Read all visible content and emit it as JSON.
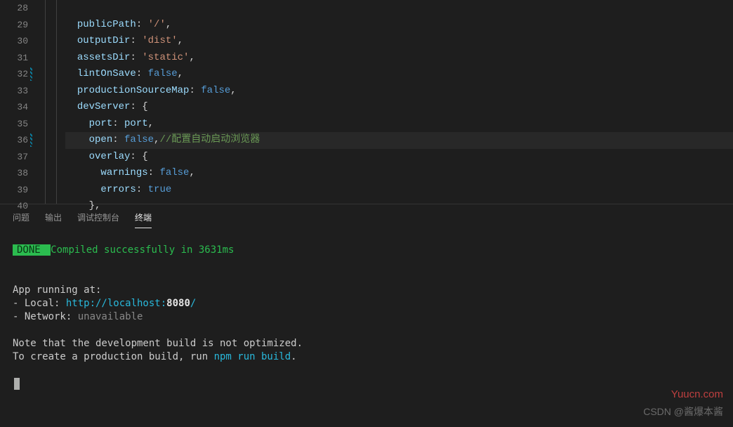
{
  "editor": {
    "lines": [
      {
        "num": "28",
        "mod": false,
        "indent": 0,
        "tokens": []
      },
      {
        "num": "29",
        "mod": false,
        "indent": 1,
        "tokens": [
          [
            "prop",
            "publicPath"
          ],
          [
            "punc",
            ": "
          ],
          [
            "str",
            "'/'"
          ],
          [
            "punc",
            ","
          ]
        ]
      },
      {
        "num": "30",
        "mod": false,
        "indent": 1,
        "tokens": [
          [
            "prop",
            "outputDir"
          ],
          [
            "punc",
            ": "
          ],
          [
            "str",
            "'dist'"
          ],
          [
            "punc",
            ","
          ]
        ]
      },
      {
        "num": "31",
        "mod": false,
        "indent": 1,
        "tokens": [
          [
            "prop",
            "assetsDir"
          ],
          [
            "punc",
            ": "
          ],
          [
            "str",
            "'static'"
          ],
          [
            "punc",
            ","
          ]
        ]
      },
      {
        "num": "32",
        "mod": true,
        "indent": 1,
        "tokens": [
          [
            "prop",
            "lintOnSave"
          ],
          [
            "punc",
            ": "
          ],
          [
            "bool",
            "false"
          ],
          [
            "punc",
            ","
          ]
        ]
      },
      {
        "num": "33",
        "mod": false,
        "indent": 1,
        "tokens": [
          [
            "prop",
            "productionSourceMap"
          ],
          [
            "punc",
            ": "
          ],
          [
            "bool",
            "false"
          ],
          [
            "punc",
            ","
          ]
        ]
      },
      {
        "num": "34",
        "mod": false,
        "indent": 1,
        "tokens": [
          [
            "prop",
            "devServer"
          ],
          [
            "punc",
            ": {"
          ]
        ]
      },
      {
        "num": "35",
        "mod": false,
        "indent": 2,
        "tokens": [
          [
            "prop",
            "port"
          ],
          [
            "punc",
            ": "
          ],
          [
            "var",
            "port"
          ],
          [
            "punc",
            ","
          ]
        ]
      },
      {
        "num": "36",
        "mod": true,
        "indent": 2,
        "hl": true,
        "tokens": [
          [
            "prop",
            "open"
          ],
          [
            "punc",
            ": "
          ],
          [
            "bool",
            "false"
          ],
          [
            "punc",
            ","
          ],
          [
            "comment",
            "//配置自动启动浏览器"
          ]
        ]
      },
      {
        "num": "37",
        "mod": false,
        "indent": 2,
        "tokens": [
          [
            "prop",
            "overlay"
          ],
          [
            "punc",
            ": {"
          ]
        ]
      },
      {
        "num": "38",
        "mod": false,
        "indent": 3,
        "tokens": [
          [
            "prop",
            "warnings"
          ],
          [
            "punc",
            ": "
          ],
          [
            "bool",
            "false"
          ],
          [
            "punc",
            ","
          ]
        ]
      },
      {
        "num": "39",
        "mod": false,
        "indent": 3,
        "tokens": [
          [
            "prop",
            "errors"
          ],
          [
            "punc",
            ": "
          ],
          [
            "bool",
            "true"
          ]
        ]
      },
      {
        "num": "40",
        "mod": false,
        "indent": 2,
        "tokens": [
          [
            "punc",
            "},"
          ]
        ]
      }
    ]
  },
  "panel": {
    "tabs": [
      {
        "label": "问题",
        "active": false
      },
      {
        "label": "输出",
        "active": false
      },
      {
        "label": "调试控制台",
        "active": false
      },
      {
        "label": "终端",
        "active": true
      }
    ]
  },
  "terminal": {
    "done_label": " DONE ",
    "compiled_msg": " Compiled successfully in 3631ms",
    "app_running": "  App running at:",
    "local_prefix": "  - Local:   ",
    "local_url": "http://localhost:",
    "local_port": "8080",
    "local_slash": "/",
    "network_prefix": "  - Network: ",
    "network_val": "unavailable",
    "note1": "  Note that the development build is not optimized.",
    "note2_a": "  To create a production build, run ",
    "note2_cmd": "npm run build",
    "note2_b": "."
  },
  "watermarks": {
    "w1": "Yuucn.com",
    "w2": "CSDN @酱爆本酱"
  }
}
